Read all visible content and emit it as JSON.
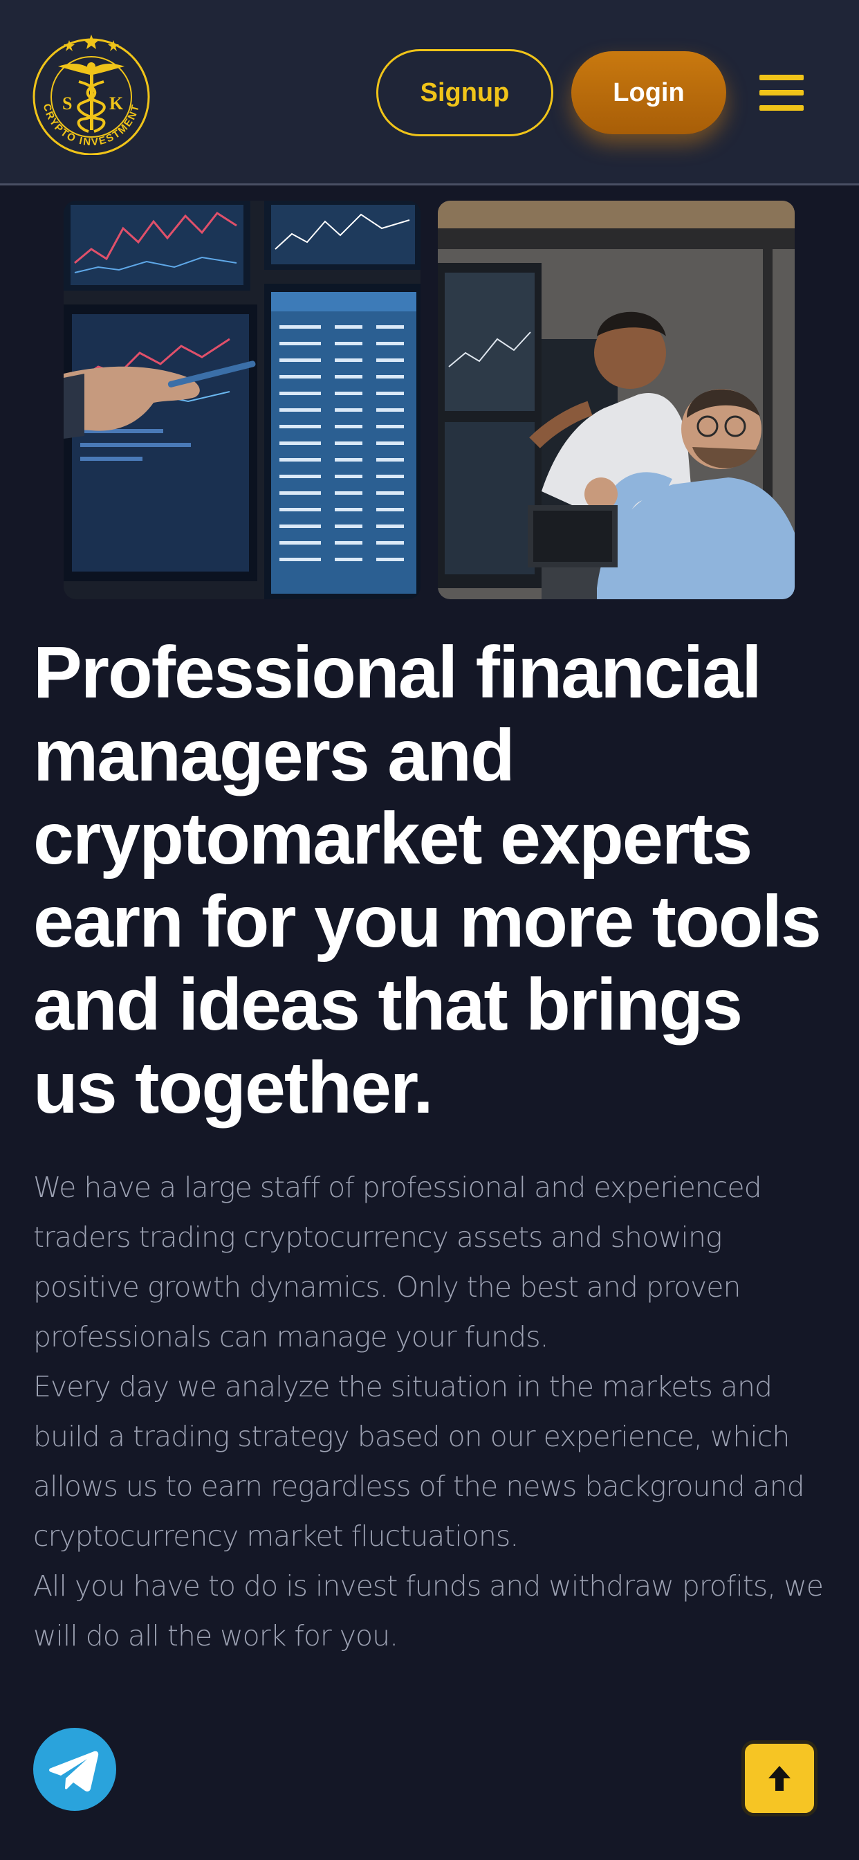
{
  "header": {
    "logo": {
      "icon": "caduceus-logo",
      "letters": [
        "S",
        "K"
      ],
      "ring_text": "CRYPTO INVESTMENT"
    },
    "signup_label": "Signup",
    "login_label": "Login",
    "menu_icon": "hamburger-menu-icon"
  },
  "hero": {
    "images": [
      {
        "icon": "trading-monitors-photo"
      },
      {
        "icon": "traders-celebrating-photo"
      }
    ],
    "headline": "Professional financial managers and cryptomarket experts earn for you more tools and ideas that brings us together.",
    "paragraphs": [
      "We have a large staff of professional and experienced traders trading cryptocurrency assets and showing positive growth dynamics. Only the best and proven professionals can manage your funds.",
      "Every day we analyze the situation in the markets and build a trading strategy based on our experience, which allows us to earn regardless of the news background and cryptocurrency market fluctuations.",
      "All you have to do is invest funds and withdraw profits, we will do all the work for you."
    ]
  },
  "floating": {
    "telegram_icon": "telegram-icon",
    "scroll_top_icon": "arrow-up-icon"
  },
  "colors": {
    "accent": "#f0c419",
    "login": "#b8690b",
    "page_bg": "#141726",
    "header_bg": "#1f2537",
    "telegram": "#2aa3dc"
  }
}
